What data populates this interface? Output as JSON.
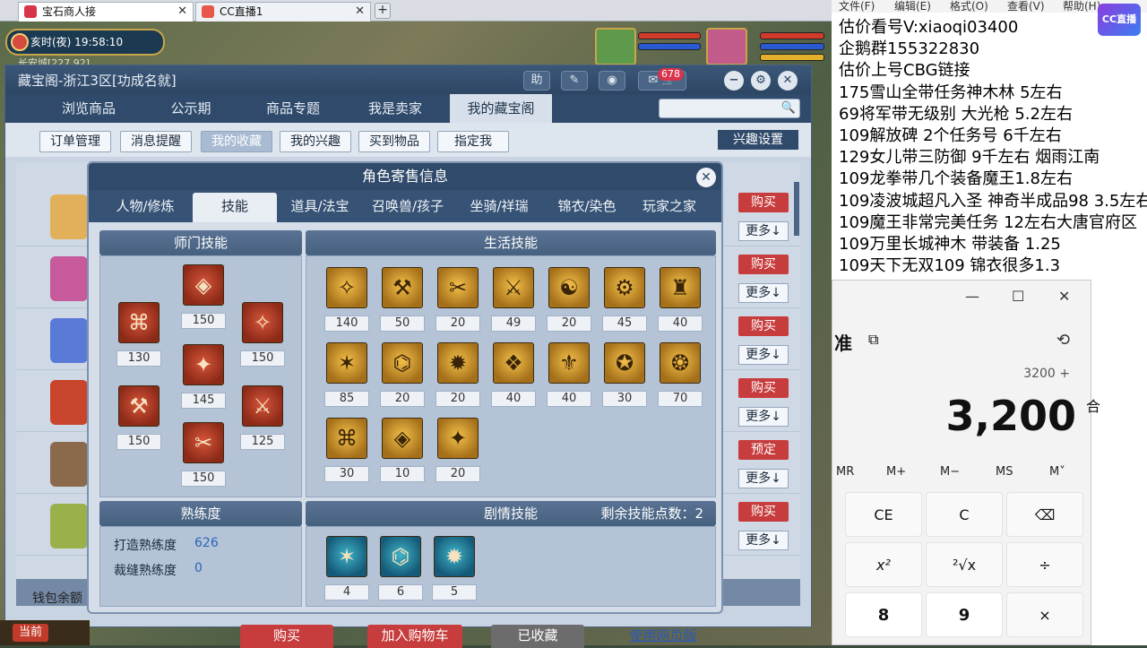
{
  "browser": {
    "tabs": [
      {
        "label": "宝石商人接",
        "close": "✕"
      },
      {
        "label": "CC直播1",
        "close": "✕"
      }
    ],
    "new_tab": "+"
  },
  "hud": {
    "time": "亥时(夜)  19:58:10",
    "location": "长安城[227,92]",
    "now_button": "当前"
  },
  "cbg": {
    "title": "藏宝阁-浙江3区[功成名就]",
    "toolbar": {
      "help": "助",
      "edit_icon": "pencil-icon",
      "record_icon": "record-icon",
      "message_count": "678",
      "cart_icon": "cart-icon"
    },
    "nav_tabs": [
      "浏览商品",
      "公示期",
      "商品专题",
      "我是卖家",
      "我的藏宝阁"
    ],
    "active_nav": "我的藏宝阁",
    "sub_tabs": [
      "订单管理",
      "消息提醒",
      "我的收藏",
      "我的兴趣",
      "买到物品",
      "指定我"
    ],
    "active_sub": "我的收藏",
    "interest_settings": "兴趣设置",
    "rows": [
      {
        "action": "购买",
        "more": "更多↓"
      },
      {
        "action": "购买",
        "more": "更多↓"
      },
      {
        "action": "购买",
        "more": "更多↓"
      },
      {
        "action": "购买",
        "more": "更多↓"
      },
      {
        "action": "预定",
        "more": "更多↓"
      },
      {
        "action": "购买",
        "more": "更多↓"
      }
    ],
    "wallet": "钱包余额",
    "bottom_buttons": [
      "购买",
      "加入购物车",
      "已收藏",
      "使用网页版"
    ]
  },
  "popup": {
    "title": "角色寄售信息",
    "close": "✕",
    "tabs": [
      "人物/修炼",
      "技能",
      "道具/法宝",
      "召唤兽/孩子",
      "坐骑/祥瑞",
      "锦衣/染色",
      "玩家之家"
    ],
    "active_tab": "技能",
    "sect_header": "师门技能",
    "sect_skills": [
      "130",
      "150",
      "145",
      "150",
      "150",
      "150",
      "125"
    ],
    "life_header": "生活技能",
    "life_skills": [
      "140",
      "50",
      "20",
      "49",
      "20",
      "45",
      "40",
      "85",
      "20",
      "20",
      "40",
      "40",
      "30",
      "70",
      "30",
      "10",
      "20"
    ],
    "prof_header": "熟练度",
    "proficiency": [
      {
        "label": "打造熟练度",
        "value": "626"
      },
      {
        "label": "裁缝熟练度",
        "value": "0"
      }
    ],
    "story_header": "剧情技能",
    "remaining_label": "剩余技能点数：",
    "remaining_value": "2",
    "story_skills": [
      "4",
      "6",
      "5"
    ]
  },
  "notepad": {
    "menu": [
      "文件(F)",
      "编辑(E)",
      "格式(O)",
      "查看(V)",
      "帮助(H)"
    ],
    "lines": [
      "估价看号V:xiaoqi03400",
      "企鹅群155322830",
      "估价上号CBG链接",
      "175雪山全带任务神木林 5左右",
      "69将军带无级别 大光枪 5.2左右",
      "109解放碑 2个任务号 6千左右",
      "129女儿带三防御 9千左右 烟雨江南",
      "109龙拳带几个装备魔王1.8左右",
      "109凌波城超凡入圣 神奇半成品98 3.5左右",
      "109魔王非常完美任务 12左右大唐官府区",
      "109万里长城神木 带装备  1.25",
      "109天下无双109  锦衣很多1.3"
    ],
    "logo": "CC直播"
  },
  "calculator": {
    "window_controls": [
      "—",
      "☐",
      "✕"
    ],
    "mode": "准",
    "expression": "3200 +",
    "display": "3,200",
    "memory": [
      "MR",
      "M+",
      "M−",
      "MS",
      "M˅"
    ],
    "keys_row1": [
      "CE",
      "C",
      "⌫"
    ],
    "keys_row2": [
      "x²",
      "²√x",
      "÷"
    ],
    "keys_row3": [
      "8",
      "9",
      "×"
    ],
    "edge_char": "合"
  }
}
